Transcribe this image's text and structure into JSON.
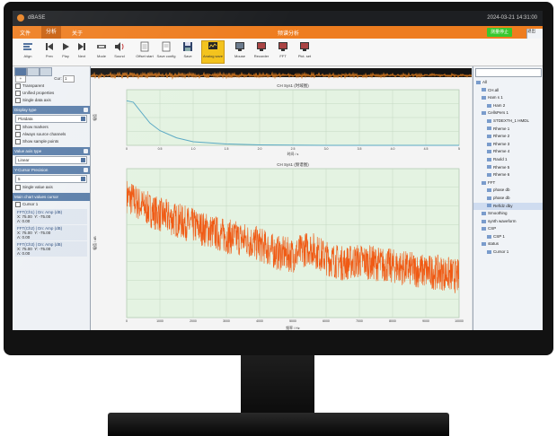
{
  "window": {
    "app_name": "dBASE",
    "clock": "2024-03-21  14:31:00"
  },
  "menu": {
    "items": [
      "文件",
      "分析",
      "关于"
    ],
    "active_index": 1,
    "center_title": "频谱分析",
    "status_button": "测量停止",
    "right_item": "退出"
  },
  "toolbar": {
    "buttons": [
      {
        "label": "Align",
        "icon": "align-icon"
      },
      {
        "label": "Prev",
        "icon": "prev-icon"
      },
      {
        "label": "Play",
        "icon": "play-icon"
      },
      {
        "label": "Next",
        "icon": "next-icon"
      },
      {
        "label": "Mode",
        "icon": "mode-icon"
      },
      {
        "label": "Sound",
        "icon": "speaker-icon"
      },
      {
        "label": "Offset start",
        "icon": "page-icon"
      },
      {
        "label": "Save config",
        "icon": "page-icon"
      },
      {
        "label": "Save",
        "icon": "disk-icon"
      },
      {
        "label": "Analog save",
        "icon": "chart-icon"
      },
      {
        "label": "Mouse",
        "icon": "monitor-icon"
      },
      {
        "label": "Recorder",
        "icon": "monitor-icon"
      },
      {
        "label": "FFT",
        "icon": "monitor-icon"
      },
      {
        "label": "Pict. set",
        "icon": "monitor-icon"
      }
    ],
    "active_index": 9
  },
  "left_panel": {
    "cursor_label": "Cur:",
    "cursor_value": "1",
    "checkboxes": [
      "Transparent",
      "Unified properties",
      "Single data axis"
    ],
    "display_header": "Display type",
    "display_select": "Plotdata",
    "display_checks": [
      "Show markers",
      "Always source channels",
      "Show sample points"
    ],
    "x_axis_header": "Value axis type",
    "x_axis_select": "Linear",
    "y_axis_header": "Y-Cursor Precision",
    "y_axis_select": "5",
    "y_axis_check": "Single value axis",
    "cursor_header": "Main chart values cursor",
    "cursor_sub": "Cursor 1",
    "coords": [
      {
        "title": "FFT(Ch1) | Dn: Amp (dB)",
        "x": "X: 75.00",
        "y": "Y: -75.00",
        "v": "A: 0.00"
      },
      {
        "title": "FFT(Ch2) | Dn: Amp (dB)",
        "x": "X: 75.00",
        "y": "Y: -75.00",
        "v": "A: 0.00"
      },
      {
        "title": "FFT(Ch3) | Dn: Amp (dB)",
        "x": "X: 75.00",
        "y": "Y: -75.00",
        "v": "A: 0.00"
      }
    ]
  },
  "charts": {
    "top": {
      "title": "CH   Sys1   (时域图)",
      "xlabel": "时间 / s",
      "ylabel": "幅值"
    },
    "bottom": {
      "title": "CH   Sys1   (频谱图)",
      "xlabel": "频率 / Hz",
      "ylabel": "幅值 / dB"
    }
  },
  "chart_data": [
    {
      "type": "line",
      "title": "CH   Sys1   (时域图)",
      "xlabel": "时间 / s",
      "ylabel": "幅值",
      "x_ticks": [
        "0",
        "0.5",
        "1.0",
        "1.5",
        "2.0",
        "2.5",
        "3.0",
        "3.5",
        "4.0",
        "4.5",
        "5"
      ],
      "xlim": [
        0,
        5
      ],
      "ylim": [
        0,
        1.25
      ],
      "grid": true,
      "series": [
        {
          "color": "#5aa9c4",
          "x": [
            0,
            0.1,
            0.2,
            0.35,
            0.5,
            0.75,
            1.0,
            1.5,
            2.0,
            3.0,
            4.0,
            5.0
          ],
          "y": [
            1.0,
            0.97,
            0.78,
            0.5,
            0.33,
            0.17,
            0.08,
            0.03,
            0.01,
            0.0,
            0.0,
            0.0
          ]
        }
      ]
    },
    {
      "type": "line",
      "title": "CH   Sys1   (频谱图)",
      "xlabel": "频率 / Hz",
      "ylabel": "幅值 / dB",
      "x_ticks": [
        "0",
        "1000",
        "2000",
        "3000",
        "4000",
        "5000",
        "6000",
        "7000",
        "8000",
        "9000",
        "10000"
      ],
      "xlim": [
        0,
        10000
      ],
      "ylim": [
        0,
        110
      ],
      "grid": true,
      "series": [
        {
          "color": "#f05a14",
          "x": [
            0,
            500,
            1000,
            1500,
            2000,
            2500,
            3000,
            3500,
            4000,
            4500,
            5000,
            5500,
            6000,
            6500,
            7000,
            7500,
            8000,
            8500,
            9000,
            9500,
            10000
          ],
          "y": [
            90,
            82,
            76,
            72,
            68,
            64,
            60,
            58,
            54,
            48,
            46,
            52,
            44,
            40,
            42,
            40,
            38,
            36,
            34,
            33,
            30
          ]
        }
      ]
    }
  ],
  "right_panel": {
    "tree": [
      {
        "label": "All",
        "indent": 0
      },
      {
        "label": "CH.all",
        "indent": 1
      },
      {
        "label": "Ham s 1",
        "indent": 1
      },
      {
        "label": "Ham 2",
        "indent": 2
      },
      {
        "label": "CellsPers 1",
        "indent": 1
      },
      {
        "label": "STDEXTH_1 HMDL",
        "indent": 2
      },
      {
        "label": "Rheme 1",
        "indent": 2
      },
      {
        "label": "Rheme 2",
        "indent": 2
      },
      {
        "label": "Rheme 3",
        "indent": 2
      },
      {
        "label": "Rheme 4",
        "indent": 2
      },
      {
        "label": "Raold 1",
        "indent": 2
      },
      {
        "label": "Rheme 5",
        "indent": 2
      },
      {
        "label": "Rheme 6",
        "indent": 2
      },
      {
        "label": "FFT",
        "indent": 1
      },
      {
        "label": "phase db",
        "indent": 2
      },
      {
        "label": "phase db",
        "indent": 2
      },
      {
        "label": "Ref/dz dby",
        "indent": 2,
        "highlight": true
      },
      {
        "label": "Smoothing",
        "indent": 1
      },
      {
        "label": "synth waveform",
        "indent": 1
      },
      {
        "label": "CSP",
        "indent": 1
      },
      {
        "label": "CSP 1",
        "indent": 2
      },
      {
        "label": "status",
        "indent": 1
      },
      {
        "label": "Cursor 1",
        "indent": 2
      }
    ]
  }
}
